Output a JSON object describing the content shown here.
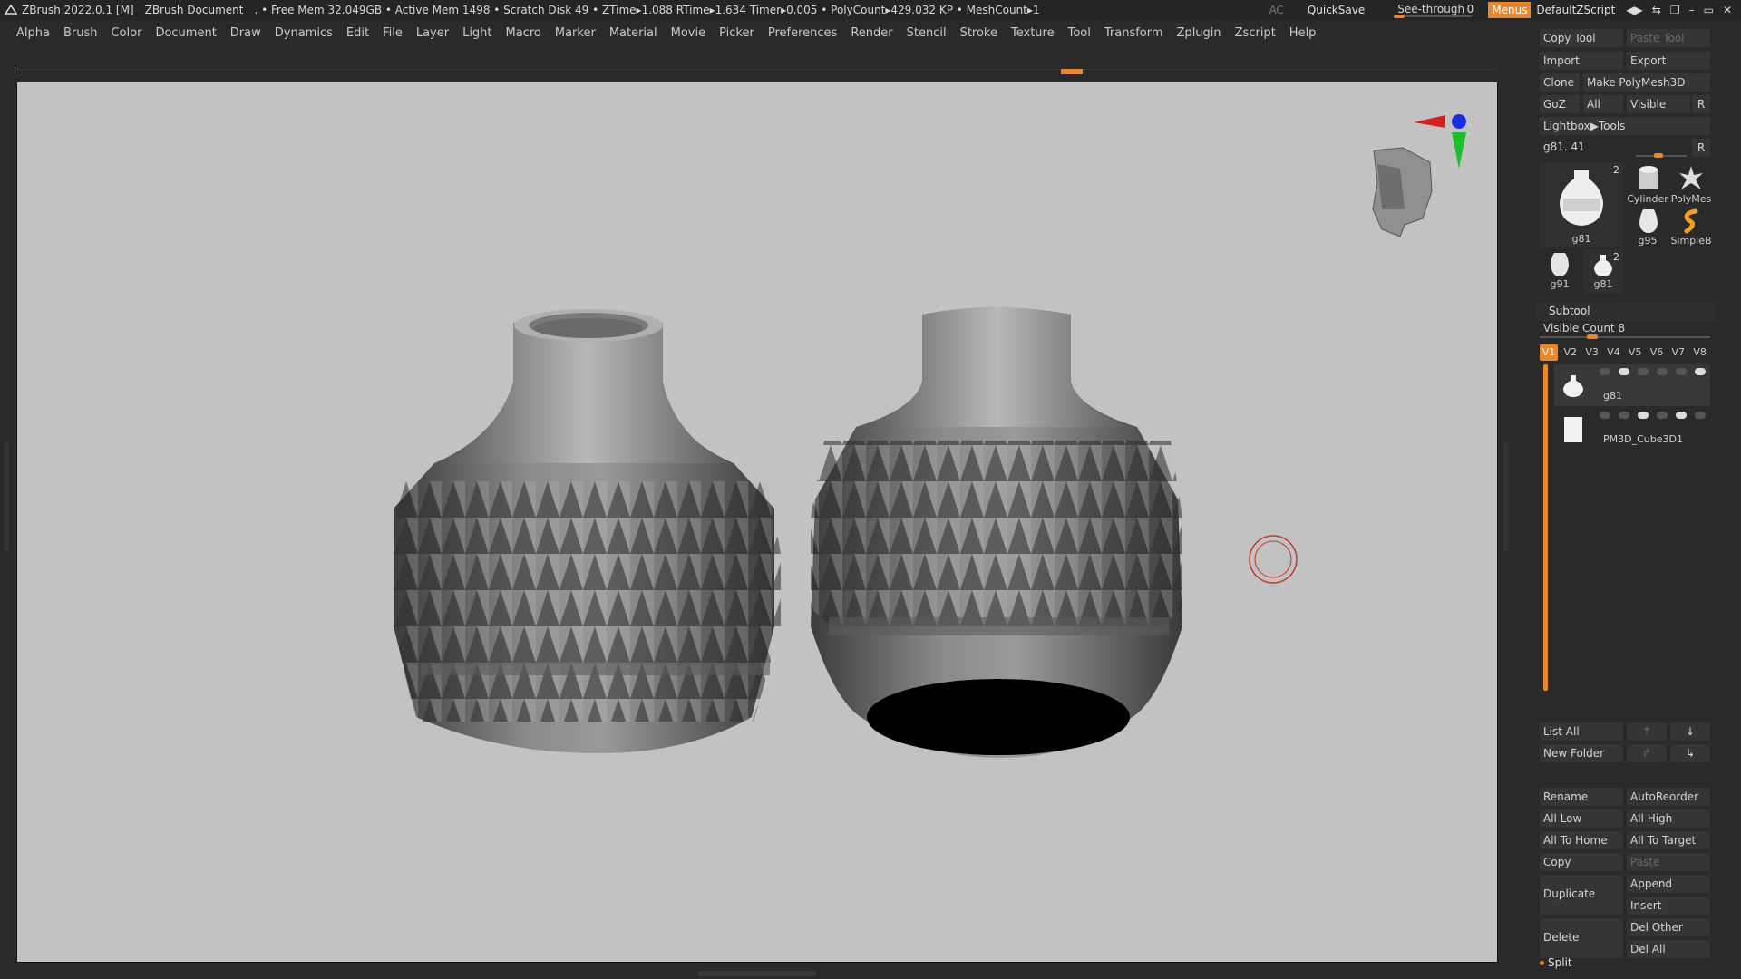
{
  "titlebar": {
    "app": "ZBrush 2022.0.1 [M]",
    "document": "ZBrush Document",
    "stats": ". • Free Mem 32.049GB • Active Mem 1498 • Scratch Disk 49 •  ZTime▸1.088 RTime▸1.634 Timer▸0.005 • PolyCount▸429.032 KP  • MeshCount▸1",
    "ac": "AC",
    "quicksave": "QuickSave",
    "see_through_label": "See-through",
    "see_through_value": "0",
    "menus": "Menus",
    "script": "DefaultZScript"
  },
  "menubar": [
    "Alpha",
    "Brush",
    "Color",
    "Document",
    "Draw",
    "Dynamics",
    "Edit",
    "File",
    "Layer",
    "Light",
    "Macro",
    "Marker",
    "Material",
    "Movie",
    "Picker",
    "Preferences",
    "Render",
    "Stencil",
    "Stroke",
    "Texture",
    "Tool",
    "Transform",
    "Zplugin",
    "Zscript",
    "Help"
  ],
  "tool_panel": {
    "copy_tool": "Copy Tool",
    "paste_tool": "Paste Tool",
    "import": "Import",
    "export": "Export",
    "clone": "Clone",
    "make_polymesh": "Make PolyMesh3D",
    "goz": "GoZ",
    "all": "All",
    "visible": "Visible",
    "r": "R",
    "lightbox": "Lightbox▶Tools",
    "current_tool": "g81. 41",
    "current_tool_r": "R",
    "thumbs": [
      {
        "label": "g81",
        "count": "2"
      },
      {
        "label": "Cylinder"
      },
      {
        "label": "PolyMes"
      },
      {
        "label": "g95"
      },
      {
        "label": "SimpleB"
      },
      {
        "label": "g91"
      },
      {
        "label": "g81",
        "count": "2"
      }
    ]
  },
  "subtool": {
    "header": "Subtool",
    "visible_count": "Visible Count 8",
    "tabs": [
      "V1",
      "V2",
      "V3",
      "V4",
      "V5",
      "V6",
      "V7",
      "V8"
    ],
    "active_tab": "V1",
    "items": [
      {
        "name": "g81"
      },
      {
        "name": "PM3D_Cube3D1"
      }
    ],
    "list_all": "List All",
    "new_folder": "New Folder",
    "rename": "Rename",
    "autoreorder": "AutoReorder",
    "all_low": "All Low",
    "all_high": "All High",
    "all_to_home": "All To Home",
    "all_to_target": "All To Target",
    "copy": "Copy",
    "paste": "Paste",
    "duplicate": "Duplicate",
    "append": "Append",
    "insert": "Insert",
    "delete": "Delete",
    "del_other": "Del Other",
    "del_all": "Del All",
    "split": "Split"
  },
  "icons": [
    "zbrush-logo-icon",
    "head-orientation-icon",
    "axis-gizmo-icon",
    "brush-cursor-icon",
    "arrow-up-icon",
    "arrow-down-icon"
  ],
  "colors": {
    "accent": "#e8872b",
    "viewport": "#c2c2c2",
    "panel": "#2a2a2a"
  }
}
